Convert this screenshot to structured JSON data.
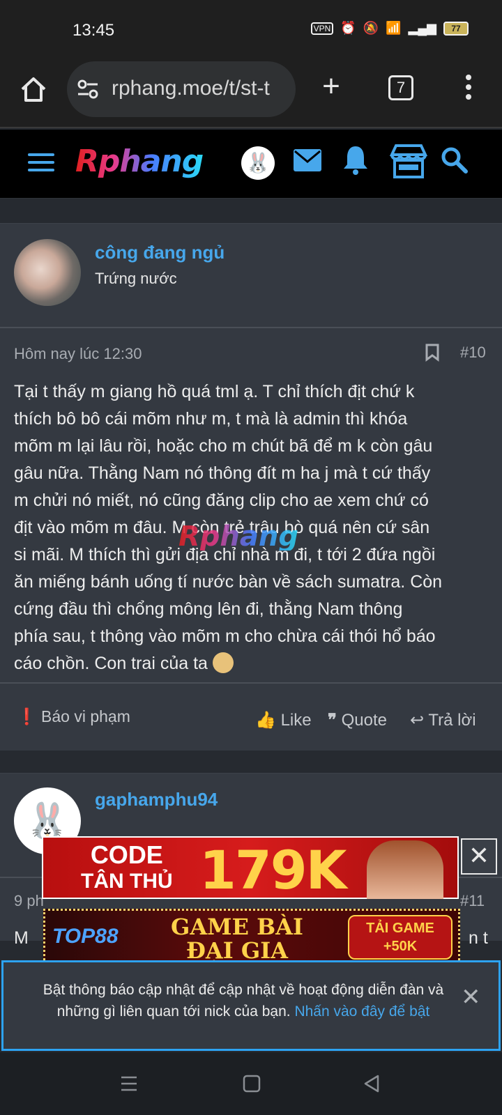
{
  "status": {
    "time": "13:45",
    "battery": "77"
  },
  "browser": {
    "url": "rphang.moe/t/st-t",
    "tab_count": "7"
  },
  "site": {
    "logo": "Rphang",
    "watermark": "Rphang"
  },
  "post1": {
    "username": "công đang ngủ",
    "user_title": "Trứng nước",
    "date": "Hôm nay lúc 12:30",
    "number": "#10",
    "lines": [
      "Tại t thấy m giang hồ quá tml ạ. T chỉ thích địt chứ k",
      "thích bô bô cái mõm như m, t mà là admin thì khóa",
      "mõm m lại lâu rồi, hoặc cho m chút bã để m k còn gâu",
      "gâu nữa. Thằng Nam nó thông đít m ha j mà t cứ thấy",
      "m chửi nó miết, nó cũng đăng clip cho ae xem chứ có",
      "địt vào mõm m đâu. M còn trẻ trâu bò quá nên cứ sân",
      "si mãi. M thích thì gửi địa chỉ nhà m đi, t tới 2 đứa ngồi",
      "ăn miếng bánh uống tí nước bàn về sách sumatra. Còn",
      "cứng đầu thì chổng mông lên đi, thằng Nam thông",
      "phía sau, t thông vào mõm m cho chừa cái thói hổ báo",
      "cáo chồn. Con trai của ta"
    ],
    "report": "Báo vi phạm",
    "like": "Like",
    "quote": "Quote",
    "reply": "Trả lời"
  },
  "post2": {
    "username": "gaphamphu94",
    "date_partial": "9 ph",
    "number": "#11",
    "body_partial_left": "M",
    "body_partial_right": "n t"
  },
  "ads": {
    "ad1_code": "CODE",
    "ad1_sub": "TÂN THỦ",
    "ad1_amount": "179K",
    "ad2_brand": "TOP88",
    "ad2_title1": "GAME BÀI",
    "ad2_title2": "ĐẠI GIA",
    "ad2_cta1": "TẢI GAME",
    "ad2_cta2": "+50K"
  },
  "notification": {
    "text": "Bật thông báo cập nhật để cập nhật về hoạt động diễn đàn và những gì liên quan tới nick của bạn.",
    "link": "Nhấn vào đây để bật"
  },
  "colors": {
    "accent": "#47a7eb",
    "post_bg": "#343941",
    "page_bg": "#262a30"
  }
}
